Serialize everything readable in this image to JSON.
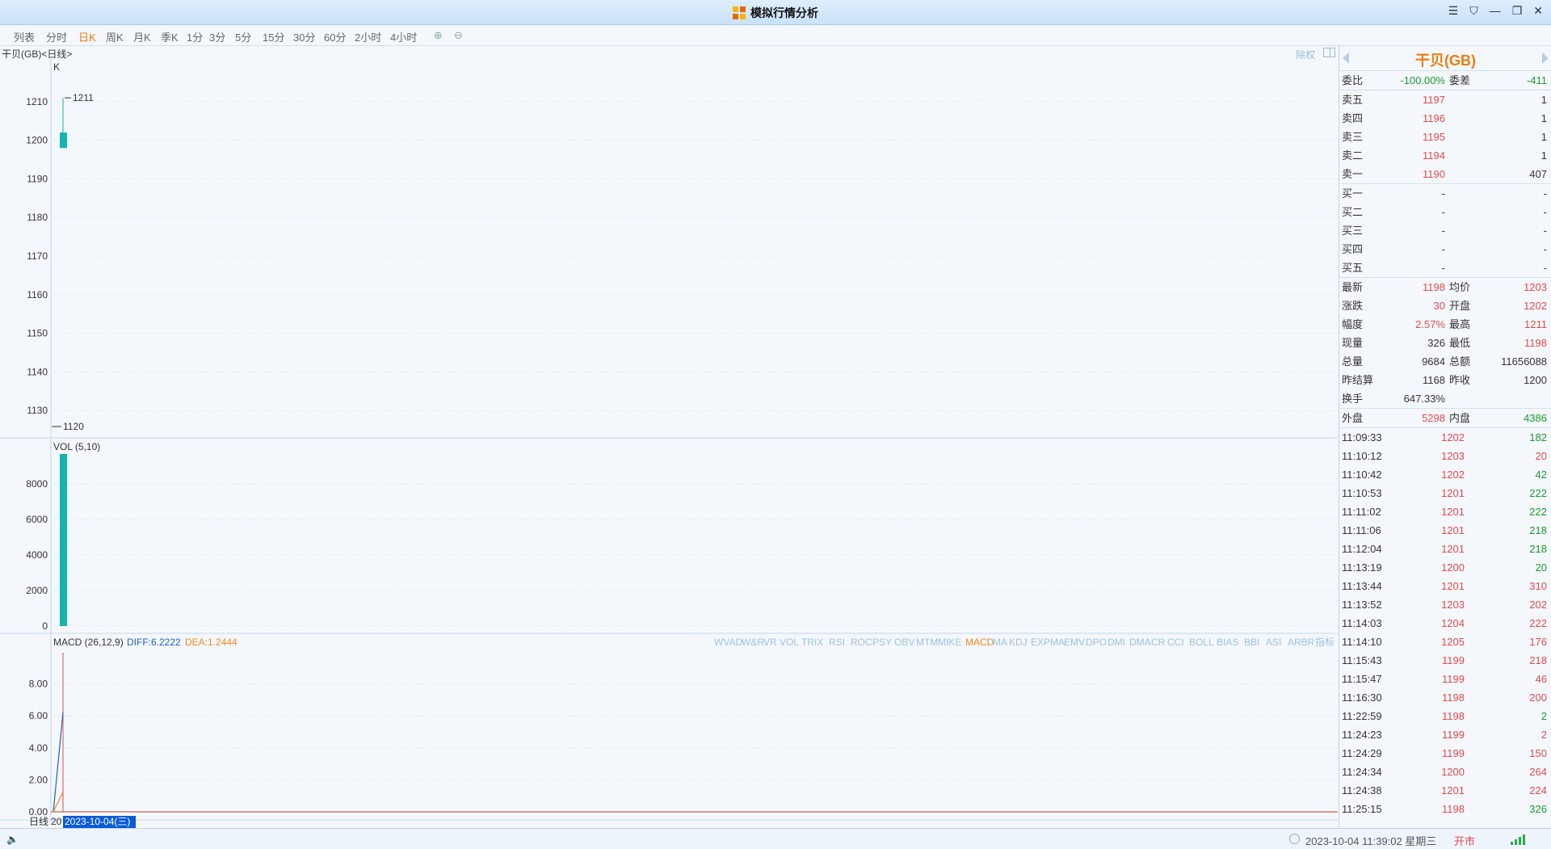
{
  "window": {
    "title": "模拟行情分析",
    "controls": [
      "☰",
      "⛉",
      "—",
      "❐",
      "✕"
    ]
  },
  "toolbar": {
    "items": [
      "列表",
      "分时",
      "日K",
      "周K",
      "月K",
      "季K",
      "1分",
      "3分",
      "5分",
      "15分",
      "30分",
      "60分",
      "2小时",
      "4小时"
    ],
    "active": "日K"
  },
  "chart_header": {
    "symbol_label": "干贝(GB)<日线>",
    "fuquan": "除权"
  },
  "kline": {
    "label": "K",
    "y_ticks": [
      "1210",
      "1200",
      "1190",
      "1180",
      "1170",
      "1160",
      "1150",
      "1140",
      "1130"
    ],
    "high_label": "1211",
    "low_label": "1120"
  },
  "vol": {
    "label": "VOL (5,10)",
    "y_ticks": [
      "8000",
      "6000",
      "4000",
      "2000",
      "0"
    ]
  },
  "macd": {
    "label": "MACD (26,12,9)",
    "diff": "DIFF:6.2222",
    "dea": "DEA:1.2444",
    "y_ticks": [
      "8.00",
      "6.00",
      "4.00",
      "2.00",
      "0.00"
    ],
    "indicators": [
      "WVAD",
      "W&R",
      "VR",
      "VOL",
      "TRIX",
      "RSI",
      "ROC",
      "PSY",
      "OBV",
      "MTM",
      "MIKE",
      "MACD",
      "MA",
      "KDJ",
      "EXPMA",
      "EMV",
      "DPO",
      "DMI",
      "DMA",
      "CR",
      "CCI",
      "BOLL",
      "BIAS",
      "BBI",
      "ASI",
      "ARBR",
      "指标"
    ],
    "active_indicator": "MACD"
  },
  "x_axis": {
    "period": "日线",
    "first_tick": "20",
    "cursor_date": "2023-10-04(三)"
  },
  "chart_data": [
    {
      "type": "candlestick",
      "title": "K",
      "x": [
        "2023-10-04"
      ],
      "open": [
        1202
      ],
      "high": [
        1211
      ],
      "low": [
        1198
      ],
      "close": [
        1198
      ],
      "ylim": [
        1125,
        1215
      ],
      "color": "#12b5b0",
      "annotations": [
        "1211",
        "1120"
      ]
    },
    {
      "type": "bar",
      "title": "VOL (5,10)",
      "categories": [
        "2023-10-04"
      ],
      "values": [
        9684
      ],
      "ylim": [
        0,
        9684
      ],
      "color": "#12b5b0"
    },
    {
      "type": "line",
      "title": "MACD (26,12,9)",
      "series": [
        {
          "name": "DIFF",
          "x": [
            "",
            "2023-10-04"
          ],
          "values": [
            0,
            6.2222
          ],
          "color": "#2060c0"
        },
        {
          "name": "DEA",
          "x": [
            "",
            "2023-10-04"
          ],
          "values": [
            0,
            1.2444
          ],
          "color": "#f08a1c"
        }
      ],
      "bar": {
        "values": [
          9.9556
        ],
        "color": "#e24a4a"
      },
      "ylim": [
        0,
        10
      ]
    }
  ],
  "quote": {
    "name": "干贝(GB)",
    "webi": {
      "label": "委比",
      "value": "-100.00%",
      "diff_label": "委差",
      "diff_value": "-411"
    },
    "asks": [
      {
        "label": "卖五",
        "price": "1197",
        "vol": "1"
      },
      {
        "label": "卖四",
        "price": "1196",
        "vol": "1"
      },
      {
        "label": "卖三",
        "price": "1195",
        "vol": "1"
      },
      {
        "label": "卖二",
        "price": "1194",
        "vol": "1"
      },
      {
        "label": "卖一",
        "price": "1190",
        "vol": "407"
      }
    ],
    "bids": [
      {
        "label": "买一",
        "price": "-",
        "vol": "-"
      },
      {
        "label": "买二",
        "price": "-",
        "vol": "-"
      },
      {
        "label": "买三",
        "price": "-",
        "vol": "-"
      },
      {
        "label": "买四",
        "price": "-",
        "vol": "-"
      },
      {
        "label": "买五",
        "price": "-",
        "vol": "-"
      }
    ],
    "stats": [
      {
        "l1": "最新",
        "v1": "1198",
        "c1": "red",
        "l2": "均价",
        "v2": "1203",
        "c2": "red"
      },
      {
        "l1": "涨跌",
        "v1": "30",
        "c1": "red",
        "l2": "开盘",
        "v2": "1202",
        "c2": "red"
      },
      {
        "l1": "幅度",
        "v1": "2.57%",
        "c1": "red",
        "l2": "最高",
        "v2": "1211",
        "c2": "red"
      },
      {
        "l1": "现量",
        "v1": "326",
        "c1": "dark",
        "l2": "最低",
        "v2": "1198",
        "c2": "red"
      },
      {
        "l1": "总量",
        "v1": "9684",
        "c1": "dark",
        "l2": "总额",
        "v2": "11656088",
        "c2": "dark"
      },
      {
        "l1": "昨结算",
        "v1": "1168",
        "c1": "dark",
        "l2": "昨收",
        "v2": "1200",
        "c2": "dark"
      },
      {
        "l1": "换手",
        "v1": "647.33%",
        "c1": "dark",
        "l2": "",
        "v2": "",
        "c2": "dark"
      }
    ],
    "outer": {
      "label": "外盘",
      "value": "5298",
      "inner_label": "内盘",
      "inner_value": "4386"
    },
    "ticks": [
      {
        "time": "11:09:33",
        "price": "1202",
        "vol": "182",
        "dir": "green"
      },
      {
        "time": "11:10:12",
        "price": "1203",
        "vol": "20",
        "dir": "red"
      },
      {
        "time": "11:10:42",
        "price": "1202",
        "vol": "42",
        "dir": "green"
      },
      {
        "time": "11:10:53",
        "price": "1201",
        "vol": "222",
        "dir": "green"
      },
      {
        "time": "11:11:02",
        "price": "1201",
        "vol": "222",
        "dir": "green"
      },
      {
        "time": "11:11:06",
        "price": "1201",
        "vol": "218",
        "dir": "green"
      },
      {
        "time": "11:12:04",
        "price": "1201",
        "vol": "218",
        "dir": "green"
      },
      {
        "time": "11:13:19",
        "price": "1200",
        "vol": "20",
        "dir": "green"
      },
      {
        "time": "11:13:44",
        "price": "1201",
        "vol": "310",
        "dir": "red"
      },
      {
        "time": "11:13:52",
        "price": "1203",
        "vol": "202",
        "dir": "red"
      },
      {
        "time": "11:14:03",
        "price": "1204",
        "vol": "222",
        "dir": "red"
      },
      {
        "time": "11:14:10",
        "price": "1205",
        "vol": "176",
        "dir": "red"
      },
      {
        "time": "11:15:43",
        "price": "1199",
        "vol": "218",
        "dir": "red"
      },
      {
        "time": "11:15:47",
        "price": "1199",
        "vol": "46",
        "dir": "red"
      },
      {
        "time": "11:16:30",
        "price": "1198",
        "vol": "200",
        "dir": "red"
      },
      {
        "time": "11:22:59",
        "price": "1198",
        "vol": "2",
        "dir": "green"
      },
      {
        "time": "11:24:23",
        "price": "1199",
        "vol": "2",
        "dir": "red"
      },
      {
        "time": "11:24:29",
        "price": "1199",
        "vol": "150",
        "dir": "red"
      },
      {
        "time": "11:24:34",
        "price": "1200",
        "vol": "264",
        "dir": "red"
      },
      {
        "time": "11:24:38",
        "price": "1201",
        "vol": "224",
        "dir": "red"
      },
      {
        "time": "11:25:15",
        "price": "1198",
        "vol": "326",
        "dir": "green"
      }
    ]
  },
  "status": {
    "datetime": "2023-10-04 11:39:02 星期三",
    "market": "开市"
  }
}
